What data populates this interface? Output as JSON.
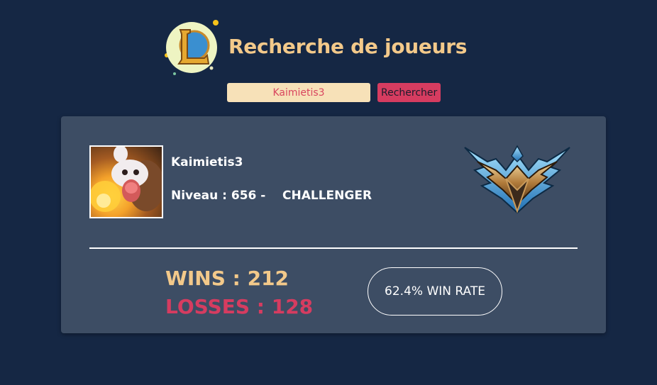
{
  "header": {
    "title": "Recherche de joueurs",
    "logo_icon": "league-of-legends-logo-icon"
  },
  "search": {
    "value": "Kaimietis3",
    "button_label": "Rechercher"
  },
  "profile": {
    "summoner_name": "Kaimietis3",
    "level_text": "Niveau : 656 -",
    "tier": "CHALLENGER",
    "avatar_icon": "poro-profile-icon",
    "emblem_icon": "challenger-emblem-icon"
  },
  "stats": {
    "wins_text": "WINS : 212",
    "losses_text": "LOSSES : 128",
    "winrate_text": "62.4% WIN RATE"
  },
  "colors": {
    "background": "#152744",
    "card": "#3d4d64",
    "gold": "#f3c98a",
    "red": "#d63c60",
    "input_bg": "#f7e1b8"
  }
}
